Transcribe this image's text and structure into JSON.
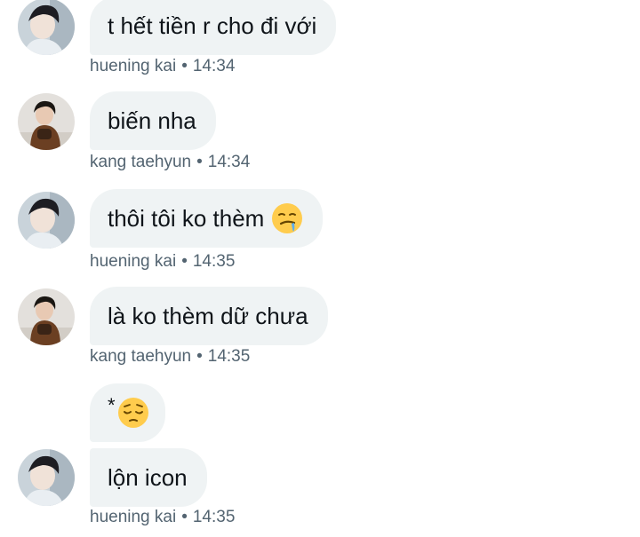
{
  "messages": [
    {
      "sender": "huening kai",
      "text": "t hết tiền r cho đi với",
      "time": "14:34"
    },
    {
      "sender": "kang taehyun",
      "text": "biến nha",
      "time": "14:34"
    },
    {
      "sender": "huening kai",
      "text": "thôi tôi ko thèm",
      "emoji": "drooling-face-icon",
      "time": "14:35"
    },
    {
      "sender": "kang taehyun",
      "text": "là ko thèm dữ chưa",
      "time": "14:35"
    },
    {
      "sender": "huening kai",
      "prefix": "*",
      "emoji": "pensive-face-icon",
      "text": "",
      "time": ""
    },
    {
      "sender": "huening kai",
      "text": "lộn icon",
      "time": "14:35"
    }
  ],
  "separator": "•",
  "colors": {
    "bubble_bg": "#eff3f4",
    "text": "#0f1419",
    "meta": "#536471",
    "emoji_yellow": "#ffcc4d"
  }
}
